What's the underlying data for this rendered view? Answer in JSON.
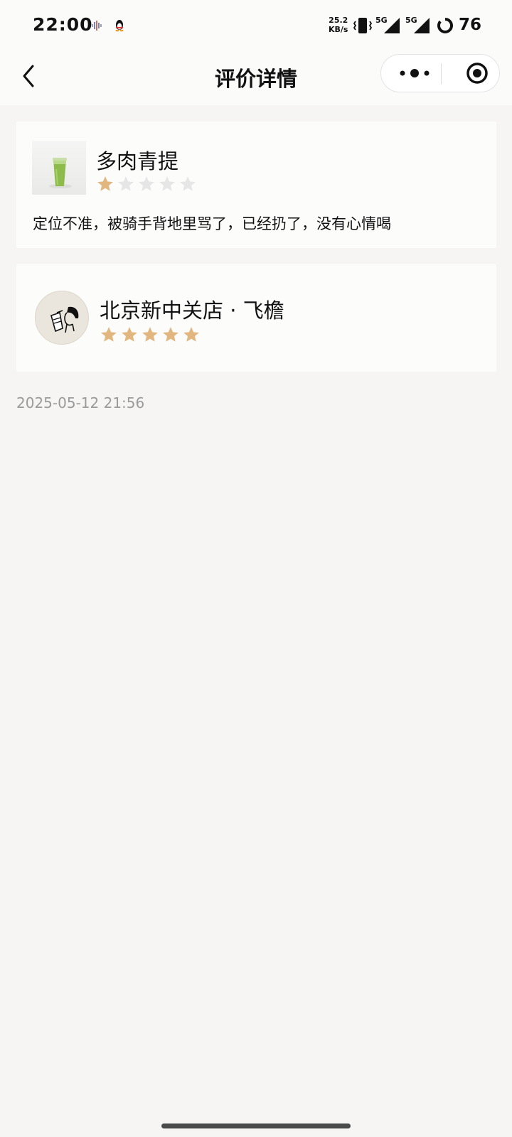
{
  "status_bar": {
    "time": "22:00",
    "net_speed_value": "25.2",
    "net_speed_unit": "KB/s",
    "sim1_label": "5G",
    "sim2_label": "5G",
    "battery_level": "76",
    "icons": [
      "sound-wave-icon",
      "qq-penguin-icon",
      "vibrate-icon",
      "signal-icon",
      "battery-ring-icon"
    ]
  },
  "nav": {
    "title": "评价详情",
    "icons": [
      "back-arrow-icon",
      "more-dots-icon",
      "target-close-icon"
    ]
  },
  "product_review": {
    "product_name": "多肉青提",
    "rating": 1,
    "max_rating": 5,
    "comment": "定位不准，被骑手背地里骂了，已经扔了，没有心情喝"
  },
  "store_review": {
    "store_name": "北京新中关店 · 飞檐",
    "rating": 5,
    "max_rating": 5
  },
  "timestamp": "2025-05-12 21:56",
  "colors": {
    "star_filled": "#e2b67f",
    "star_empty": "#e6e6e6",
    "background": "#f6f5f3",
    "card": "#fcfcfb"
  }
}
